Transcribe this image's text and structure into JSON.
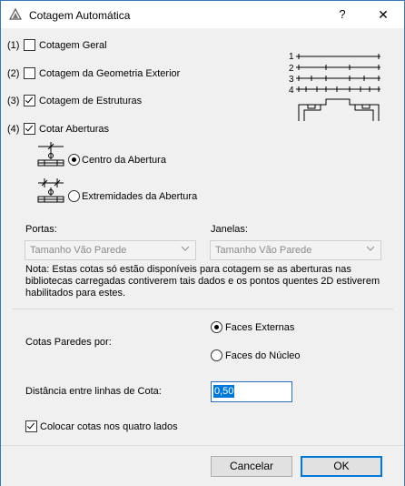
{
  "window": {
    "title": "Cotagem Automática",
    "help_glyph": "?",
    "close_glyph": "✕"
  },
  "options": [
    {
      "num": "(1)",
      "label": "Cotagem Geral",
      "checked": false
    },
    {
      "num": "(2)",
      "label": "Cotagem da Geometria Exterior",
      "checked": false
    },
    {
      "num": "(3)",
      "label": "Cotagem de Estruturas",
      "checked": true
    },
    {
      "num": "(4)",
      "label": "Cotar Aberturas",
      "checked": true
    }
  ],
  "preview_line_numbers": [
    "1",
    "2",
    "3",
    "4"
  ],
  "openings": {
    "centro_label": "Centro da Abertura",
    "centro_selected": true,
    "extremidades_label": "Extremidades da Abertura",
    "extremidades_selected": false
  },
  "portas": {
    "label": "Portas:",
    "value": "Tamanho Vão Parede"
  },
  "janelas": {
    "label": "Janelas:",
    "value": "Tamanho Vão Parede"
  },
  "note": "Nota: Estas cotas só estão disponíveis para cotagem se as aberturas nas bibliotecas carregadas contiverem tais dados e os pontos quentes 2D estiverem habilitados para estes.",
  "walls": {
    "label": "Cotas Paredes por:",
    "faces_externas": "Faces Externas",
    "faces_externas_selected": true,
    "faces_nucleo": "Faces do Núcleo",
    "faces_nucleo_selected": false
  },
  "distance": {
    "label": "Distância entre linhas de Cota:",
    "value": "0,50"
  },
  "four_sides": {
    "label": "Colocar cotas nos quatro lados",
    "checked": true
  },
  "buttons": {
    "cancel": "Cancelar",
    "ok": "OK"
  },
  "colors": {
    "accent": "#0078d7",
    "disabled_text": "#8a8a8a"
  }
}
